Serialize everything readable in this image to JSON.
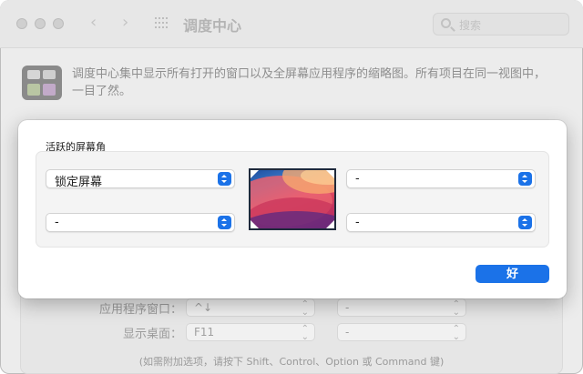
{
  "window": {
    "title": "调度中心",
    "search_placeholder": "搜索",
    "description": "调度中心集中显示所有打开的窗口以及全屏幕应用程序的缩略图。所有项目在同一视图中，一目了然。"
  },
  "background_settings": {
    "rows": [
      {
        "label": "应用程序窗口：",
        "primary_value": "^↓",
        "secondary_value": "-"
      },
      {
        "label": "显示桌面：",
        "primary_value": "F11",
        "secondary_value": "-"
      }
    ],
    "note": "(如需附加选项，请按下 Shift、Control、Option 或 Command 键)"
  },
  "sheet": {
    "title": "活跃的屏幕角",
    "corners": {
      "top_left": "锁定屏幕",
      "top_right": "-",
      "bottom_left": "-",
      "bottom_right": "-"
    },
    "ok_label": "好"
  },
  "colors": {
    "accent": "#1b72e8",
    "sheet_bg": "#ffffff",
    "window_bg": "#ececec"
  }
}
